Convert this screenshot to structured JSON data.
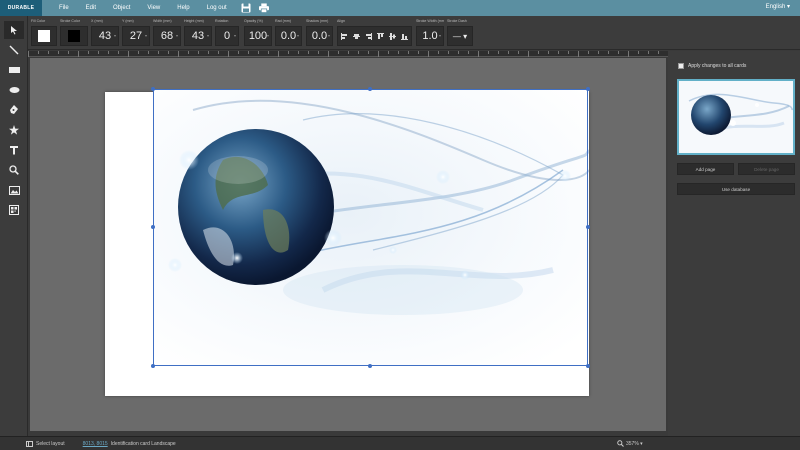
{
  "menubar": {
    "logo": "DURABLE",
    "items": [
      "File",
      "Edit",
      "Object",
      "View",
      "Help",
      "Log out"
    ],
    "language": "English"
  },
  "props": {
    "fill_label": "Fill Color",
    "stroke_label": "Stroke Color",
    "x_label": "X (mm)",
    "x_value": "43",
    "y_label": "Y (mm)",
    "y_value": "27",
    "width_label": "Width (mm)",
    "width_value": "68",
    "height_label": "Height (mm)",
    "height_value": "43",
    "rotation_label": "Rotation",
    "rotation_value": "0",
    "opacity_label": "Opacity (%)",
    "opacity_value": "100",
    "radius_label": "Rad (mm)",
    "radius_value": "0.0",
    "shadow_label": "Shadow (mm)",
    "shadow_value": "0.0",
    "align_label": "Align",
    "stroke_width_label": "Stroke Width (mm)",
    "stroke_width_value": "1.0",
    "stroke_dash_label": "Stroke Dash",
    "fill_color": "#ffffff",
    "stroke_color": "#000000"
  },
  "right_panel": {
    "apply_label": "Apply changes to all cards",
    "add_page": "Add page",
    "delete_page": "Delete page",
    "use_database": "Use database"
  },
  "status": {
    "select_layout": "Select layout",
    "layout_link": "8013, 8015",
    "layout_name": "Identification card Landscape",
    "zoom": "357% ▾"
  },
  "colors": {
    "menubar": "#5b8fa1",
    "selection": "#3f6fc4",
    "thumb_border": "#62b0c8"
  }
}
